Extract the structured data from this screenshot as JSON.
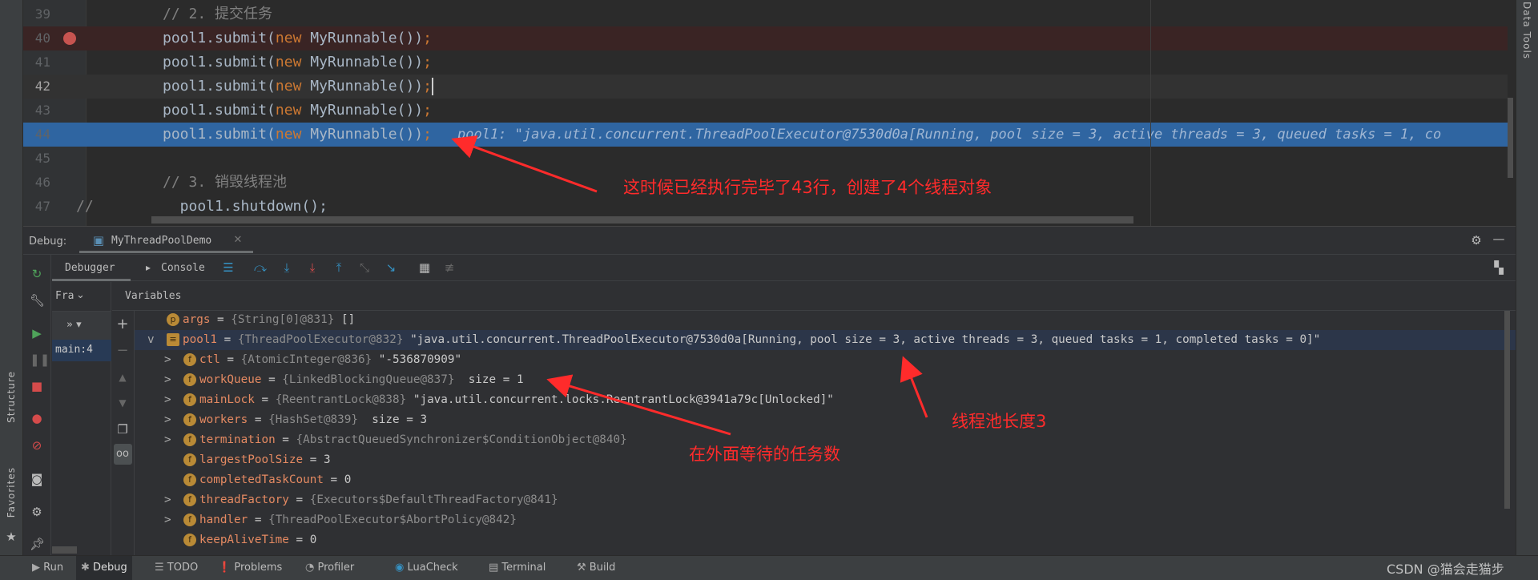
{
  "colors": {
    "accent": "#2f65a1",
    "annotation": "#ff2b2b",
    "breakpoint": "#c75450",
    "keyword": "#cc7832",
    "variable_name": "#e58a62"
  },
  "editor": {
    "lines": [
      {
        "num": "39",
        "parts": [
          {
            "c": "cm",
            "t": "// 2. 提交任务"
          }
        ]
      },
      {
        "num": "40",
        "breakpoint": true,
        "parts": [
          {
            "c": "",
            "t": "pool1.submit("
          },
          {
            "c": "kw",
            "t": "new"
          },
          {
            "c": "",
            "t": " MyRunnable())"
          },
          {
            "c": "kw",
            "t": ";"
          }
        ]
      },
      {
        "num": "41",
        "parts": [
          {
            "c": "",
            "t": "pool1.submit("
          },
          {
            "c": "kw",
            "t": "new"
          },
          {
            "c": "",
            "t": " MyRunnable())"
          },
          {
            "c": "kw",
            "t": ";"
          }
        ]
      },
      {
        "num": "42",
        "caret": true,
        "parts": [
          {
            "c": "",
            "t": "pool1.submit("
          },
          {
            "c": "kw",
            "t": "new"
          },
          {
            "c": "",
            "t": " MyRunnable())"
          },
          {
            "c": "kw",
            "t": ";"
          }
        ]
      },
      {
        "num": "43",
        "parts": [
          {
            "c": "",
            "t": "pool1.submit("
          },
          {
            "c": "kw",
            "t": "new"
          },
          {
            "c": "",
            "t": " MyRunnable())"
          },
          {
            "c": "kw",
            "t": ";"
          }
        ]
      },
      {
        "num": "44",
        "current": true,
        "parts": [
          {
            "c": "",
            "t": "pool1.submit("
          },
          {
            "c": "kw",
            "t": "new"
          },
          {
            "c": "",
            "t": " MyRunnable())"
          },
          {
            "c": "kw",
            "t": ";"
          }
        ],
        "hint": "pool1: \"java.util.concurrent.ThreadPoolExecutor@7530d0a[Running, pool size = 3, active threads = 3, queued tasks = 1, co"
      },
      {
        "num": "45",
        "parts": []
      },
      {
        "num": "46",
        "parts": [
          {
            "c": "cm",
            "t": "// 3. 销毁线程池"
          }
        ]
      },
      {
        "num": "47",
        "prefix": "//",
        "parts": [
          {
            "c": "",
            "t": "  pool1.shutdown();"
          }
        ]
      }
    ]
  },
  "right_stripe": {
    "label": "Data Tools"
  },
  "left_stripe": {
    "structure": "Structure",
    "favorites": "Favorites"
  },
  "debug": {
    "label": "Debug:",
    "tab": "MyThreadPoolDemo",
    "tabs": {
      "debugger": "Debugger",
      "console": "Console"
    },
    "frames_label": "Fra",
    "frames_item": "main:4",
    "variables_label": "Variables",
    "variables": [
      {
        "expand": "",
        "icon": "p",
        "name": "args",
        "type": "{String[0]@831}",
        "value": " []"
      },
      {
        "expand": "v",
        "icon": "≡",
        "name": "pool1",
        "type": "{ThreadPoolExecutor@832}",
        "value": " \"java.util.concurrent.ThreadPoolExecutor@7530d0a[Running, pool size = 3, active threads = 3, queued tasks = 1, completed tasks = 0]\"",
        "selected": true
      },
      {
        "expand": ">",
        "icon": "f",
        "name": "ctl",
        "type": "{AtomicInteger@836}",
        "value": " \"-536870909\"",
        "child": true
      },
      {
        "expand": ">",
        "icon": "f",
        "name": "workQueue",
        "type": "{LinkedBlockingQueue@837}",
        "value": "  size = 1",
        "child": true
      },
      {
        "expand": ">",
        "icon": "f",
        "name": "mainLock",
        "type": "{ReentrantLock@838}",
        "value": " \"java.util.concurrent.locks.ReentrantLock@3941a79c[Unlocked]\"",
        "child": true
      },
      {
        "expand": ">",
        "icon": "f",
        "name": "workers",
        "type": "{HashSet@839}",
        "value": "  size = 3",
        "child": true
      },
      {
        "expand": ">",
        "icon": "f",
        "name": "termination",
        "type": "{AbstractQueuedSynchronizer$ConditionObject@840}",
        "value": "",
        "child": true
      },
      {
        "expand": "",
        "icon": "f",
        "name": "largestPoolSize",
        "type": "",
        "value": "3",
        "child": true
      },
      {
        "expand": "",
        "icon": "f",
        "name": "completedTaskCount",
        "type": "",
        "value": "0",
        "child": true
      },
      {
        "expand": ">",
        "icon": "f",
        "name": "threadFactory",
        "type": "{Executors$DefaultThreadFactory@841}",
        "value": "",
        "child": true
      },
      {
        "expand": ">",
        "icon": "f",
        "name": "handler",
        "type": "{ThreadPoolExecutor$AbortPolicy@842}",
        "value": "",
        "child": true
      },
      {
        "expand": "",
        "icon": "f",
        "name": "keepAliveTime",
        "type": "",
        "value": "0",
        "child": true
      }
    ]
  },
  "bottom_bar": {
    "items": [
      "Run",
      "Debug",
      "TODO",
      "Problems",
      "Profiler",
      "LuaCheck",
      "Terminal",
      "Build"
    ],
    "active": "Debug"
  },
  "annotations": {
    "a1": "这时候已经执行完毕了43行，创建了4个线程对象",
    "a2": "线程池长度3",
    "a3": "在外面等待的任务数"
  },
  "watermark": "CSDN @猫会走猫步"
}
